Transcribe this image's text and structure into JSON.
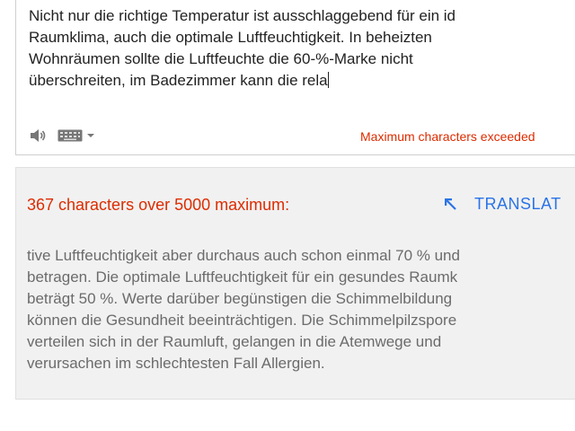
{
  "source": {
    "lines": [
      "Nicht nur die richtige Temperatur ist ausschlaggebend für ein id",
      "Raumklima, auch die optimale Luftfeuchtigkeit. In beheizten",
      "Wohnräumen sollte die Luftfeuchte die 60-%-Marke nicht",
      "überschreiten, im Badezimmer kann die rela"
    ],
    "warning": "Maximum characters exceeded"
  },
  "output": {
    "over_limit": "367 characters over 5000 maximum:",
    "translate_label": "TRANSLAT",
    "overflow_lines": [
      "tive Luftfeuchtigkeit aber durchaus auch schon einmal 70 % und",
      "betragen. Die optimale Luftfeuchtigkeit für ein gesundes Raumk",
      "beträgt 50 %. Werte darüber begünstigen die Schimmelbildung",
      "können die Gesundheit beeinträchtigen. Die Schimmelpilzspore",
      "verteilen sich in der Raumluft, gelangen in die Atemwege und",
      "verursachen im schlechtesten Fall Allergien."
    ]
  },
  "icons": {
    "speaker": "speaker-icon",
    "keyboard": "keyboard-icon",
    "dropdown": "dropdown-arrow-icon",
    "translate": "arrow-up-left-icon"
  },
  "colors": {
    "warning": "#dd2c00",
    "link": "#2a73e8",
    "overflow_text": "#6b6b6b",
    "output_background": "#f1f1f1"
  }
}
